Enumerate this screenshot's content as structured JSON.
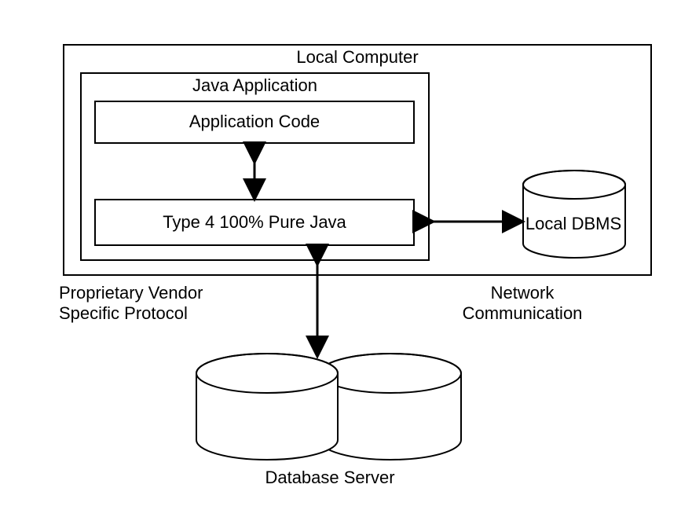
{
  "title_local_computer": "Local Computer",
  "title_java_app": "Java Application",
  "box_app_code": "Application Code",
  "box_type4": "Type 4 100% Pure Java",
  "label_local_dbms": "Local DBMS",
  "label_proprietary": "Proprietary Vendor\nSpecific Protocol",
  "label_network": "Network\nCommunication",
  "label_db_server": "Database Server"
}
